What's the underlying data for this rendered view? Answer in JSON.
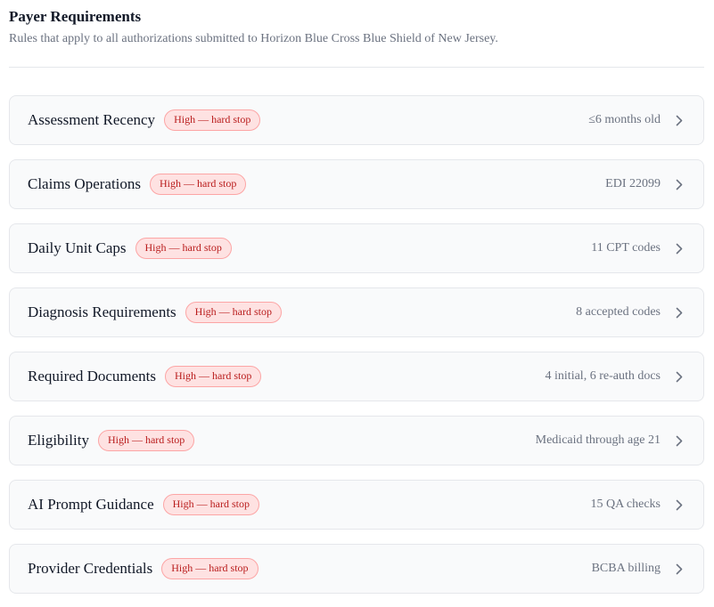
{
  "header": {
    "title": "Payer Requirements",
    "subtitle": "Rules that apply to all authorizations submitted to Horizon Blue Cross Blue Shield of New Jersey."
  },
  "colors": {
    "badge_text": "#b91c1c",
    "badge_bg": "#fee2e2",
    "badge_border": "#fca5a5",
    "row_bg": "#f9fafb",
    "row_border": "#e5e7eb"
  },
  "requirements": [
    {
      "name": "Assessment Recency",
      "badge": "High — hard stop",
      "summary": "≤6 months old",
      "icon": "chevron-right-icon"
    },
    {
      "name": "Claims Operations",
      "badge": "High — hard stop",
      "summary": "EDI 22099",
      "icon": "chevron-right-icon"
    },
    {
      "name": "Daily Unit Caps",
      "badge": "High — hard stop",
      "summary": "11 CPT codes",
      "icon": "chevron-right-icon"
    },
    {
      "name": "Diagnosis Requirements",
      "badge": "High — hard stop",
      "summary": "8 accepted codes",
      "icon": "chevron-right-icon"
    },
    {
      "name": "Required Documents",
      "badge": "High — hard stop",
      "summary": "4 initial, 6 re-auth docs",
      "icon": "chevron-right-icon"
    },
    {
      "name": "Eligibility",
      "badge": "High — hard stop",
      "summary": "Medicaid through age 21",
      "icon": "chevron-right-icon"
    },
    {
      "name": "AI Prompt Guidance",
      "badge": "High — hard stop",
      "summary": "15 QA checks",
      "icon": "chevron-right-icon"
    },
    {
      "name": "Provider Credentials",
      "badge": "High — hard stop",
      "summary": "BCBA billing",
      "icon": "chevron-right-icon"
    }
  ]
}
